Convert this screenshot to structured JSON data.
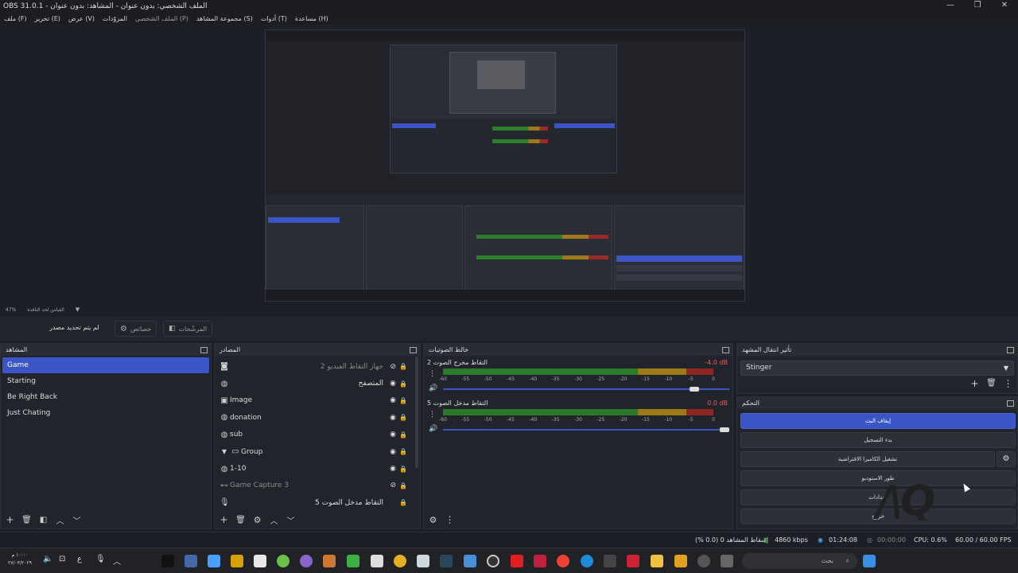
{
  "window": {
    "title": "OBS 31.0.1 - الملف الشخصي: بدون عنوان - المشاهد: بدون عنوان",
    "menu": [
      "ملف (F)",
      "تحرير (E)",
      "عرض (V)",
      "المزوّدات",
      "الملف الشخصي (P)",
      "مجموعة المشاهد (S)",
      "أدوات (T)",
      "مساعدة (H)"
    ],
    "controls": [
      "—",
      "❐",
      "✕"
    ]
  },
  "preview": {
    "zoom": "47%",
    "scale_label": "القياس لحد النافذة"
  },
  "context_bar": {
    "no_source": "لم يتم تحديد مصدر",
    "properties": "خصائص",
    "filters": "المرشّحات"
  },
  "scenes": {
    "title": "المشاهد",
    "items": [
      "Game",
      "Starting",
      "Be Right Back",
      "Just Chating"
    ],
    "active_index": 0
  },
  "sources": {
    "title": "المصادر",
    "items": [
      {
        "name": "جهاز التقاط الفيديو 2",
        "icon": "camera-icon",
        "rtl": true,
        "visible": false
      },
      {
        "name": "المتصفح",
        "icon": "globe-icon",
        "rtl": true,
        "visible": true
      },
      {
        "name": "Image",
        "icon": "image-icon",
        "rtl": false,
        "visible": true
      },
      {
        "name": "donation",
        "icon": "globe-icon",
        "rtl": false,
        "visible": true
      },
      {
        "name": "sub",
        "icon": "globe-icon",
        "rtl": false,
        "visible": true
      },
      {
        "name": "Group",
        "icon": "folder-icon",
        "rtl": false,
        "visible": true
      },
      {
        "name": "1-10",
        "icon": "globe-icon",
        "rtl": false,
        "visible": true
      },
      {
        "name": "Game Capture 3",
        "icon": "gamepad-icon",
        "rtl": false,
        "visible": false
      },
      {
        "name": "التقاط مدخل الصوت 5",
        "icon": "mic-icon",
        "rtl": true,
        "visible": true
      }
    ]
  },
  "mixer": {
    "title": "خالط الصوتيات",
    "channels": [
      {
        "name": "التقاط مخرج الصوت 2",
        "db": "-4.0 dB",
        "volume": 0.85
      },
      {
        "name": "التقاط مدخل الصوت 5",
        "db": "0.0 dB",
        "volume": 1.0
      }
    ],
    "scale": [
      "-60",
      "-55",
      "-50",
      "-45",
      "-40",
      "-35",
      "-30",
      "-25",
      "-20",
      "-15",
      "-10",
      "-5",
      "0"
    ]
  },
  "transitions": {
    "title": "تأثير انتقال المشهد",
    "selected": "Stinger"
  },
  "controls": {
    "title": "التحكم",
    "stop_stream": "إيقاف البث",
    "start_recording": "بدء التسجيل",
    "virtual_camera": "تشغيل الكاميرا الافتراضية",
    "studio_mode": "طور الاستوديو",
    "settings": "إعدادات",
    "exit": "خروج"
  },
  "status": {
    "dropped": "إسقاط المشاهد 0 (0.0 %)",
    "bitrate": "4860 kbps",
    "stream_time": "01:24:08",
    "rec_time": "00:00:00",
    "cpu": "CPU: 0.6%",
    "fps": "60.00 / 60.00 FPS"
  },
  "taskbar": {
    "search": "بحث",
    "time": "١٠:٠٠ م",
    "date": "٢٧/٠٣/٢٠٢٩",
    "lang": "ع"
  },
  "colors": {
    "accent": "#3b55c7",
    "bg": "#1d1f26",
    "panel": "#22242b"
  }
}
